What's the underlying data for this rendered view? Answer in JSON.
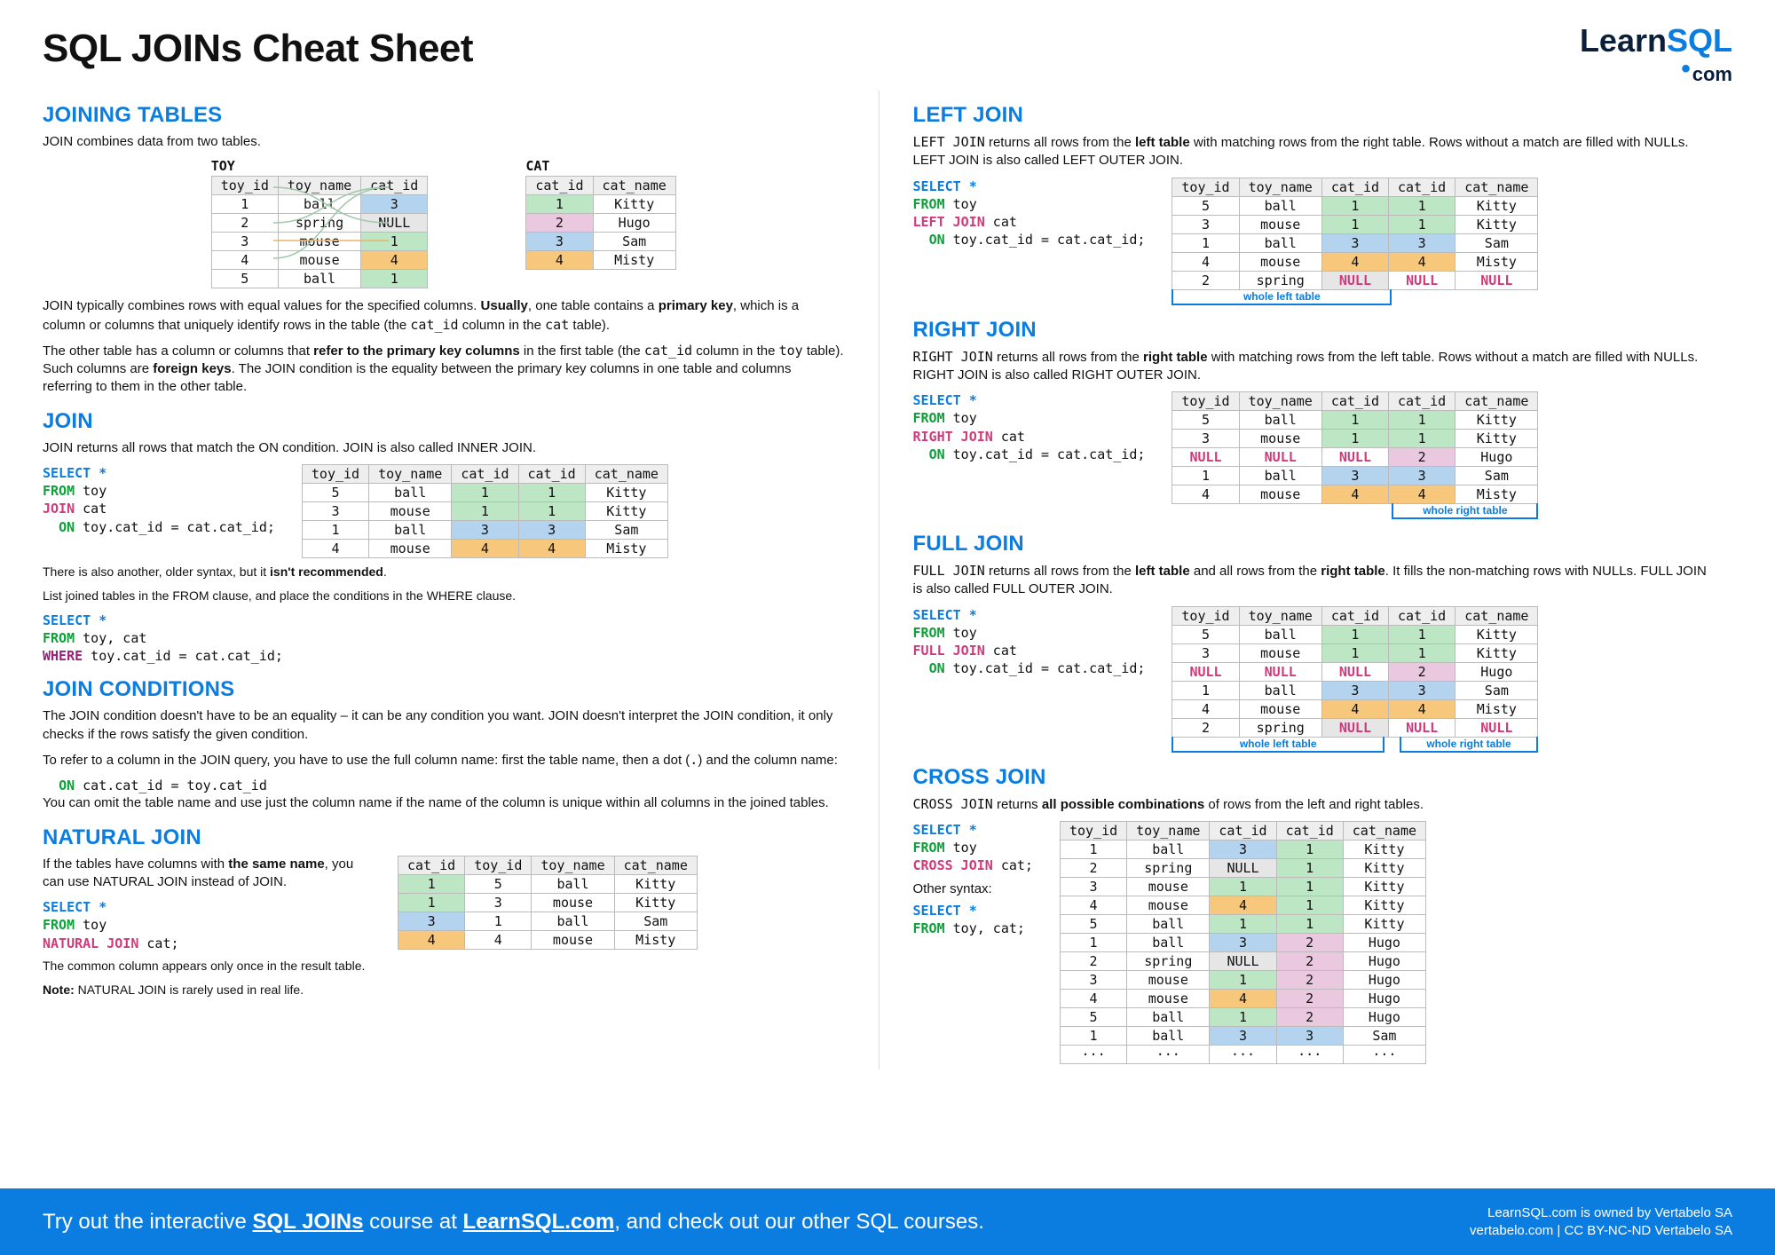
{
  "title": "SQL JOINs Cheat Sheet",
  "logo": {
    "learn": "Learn",
    "sql": "SQL",
    "com": "com"
  },
  "left": {
    "joining_tables": {
      "h": "JOINING TABLES",
      "intro": "JOIN combines data from two tables.",
      "toy_label": "TOY",
      "cat_label": "CAT",
      "toy_cols": [
        "toy_id",
        "toy_name",
        "cat_id"
      ],
      "toy_rows": [
        [
          "1",
          "ball",
          "3"
        ],
        [
          "2",
          "spring",
          "NULL"
        ],
        [
          "3",
          "mouse",
          "1"
        ],
        [
          "4",
          "mouse",
          "4"
        ],
        [
          "5",
          "ball",
          "1"
        ]
      ],
      "cat_cols": [
        "cat_id",
        "cat_name"
      ],
      "cat_rows": [
        [
          "1",
          "Kitty"
        ],
        [
          "2",
          "Hugo"
        ],
        [
          "3",
          "Sam"
        ],
        [
          "4",
          "Misty"
        ]
      ],
      "p1a": "JOIN typically combines rows with equal values for the specified columns. ",
      "p1b": "Usually",
      "p1c": ", one table contains a ",
      "p1d": "primary key",
      "p1e": ", which is a column or columns that uniquely identify rows in the table (the ",
      "p1f": "cat_id",
      "p1g": " column in the ",
      "p1h": "cat",
      "p1i": " table).",
      "p2a": "The other table has a column or columns that ",
      "p2b": "refer to the primary key columns",
      "p2c": " in the first table (the ",
      "p2d": "cat_id",
      "p2e": " column in the ",
      "p2f": "toy",
      "p2g": " table). Such columns are ",
      "p2h": "foreign keys",
      "p2i": ". The JOIN condition is the equality between the primary key columns in one table and columns referring to them in the other table."
    },
    "join": {
      "h": "JOIN",
      "intro": "JOIN returns all rows that match the ON condition. JOIN is also called INNER JOIN.",
      "sql": {
        "sel": "SELECT *",
        "from": "FROM toy",
        "join": "JOIN cat",
        "on": "  ON toy.cat_id = cat.cat_id;"
      },
      "cols": [
        "toy_id",
        "toy_name",
        "cat_id",
        "cat_id",
        "cat_name"
      ],
      "rows": [
        [
          "5",
          "ball",
          "1",
          "1",
          "Kitty"
        ],
        [
          "3",
          "mouse",
          "1",
          "1",
          "Kitty"
        ],
        [
          "1",
          "ball",
          "3",
          "3",
          "Sam"
        ],
        [
          "4",
          "mouse",
          "4",
          "4",
          "Misty"
        ]
      ],
      "note1a": "There is also another, older syntax, but it ",
      "note1b": "isn't recommended",
      "note1c": ".",
      "note2": "List joined tables in the FROM clause, and place the conditions in the WHERE clause.",
      "sql2": {
        "sel": "SELECT *",
        "from": "FROM toy, cat",
        "where": "WHERE toy.cat_id = cat.cat_id;"
      }
    },
    "join_cond": {
      "h": "JOIN CONDITIONS",
      "p1": "The JOIN condition doesn't have to be an equality – it can be any condition you want. JOIN doesn't interpret the JOIN condition, it only checks if the rows satisfy the given condition.",
      "p2a": "To refer to a column in the JOIN query, you have to use the full column name: first the table name, then a dot (",
      "p2b": ".",
      "p2c": ") and the column name:",
      "code": "  ON cat.cat_id = toy.cat_id",
      "p3": "You can omit the table name and use just the column name if the name of the column is unique within all columns in the joined tables."
    },
    "natural": {
      "h": "NATURAL JOIN",
      "p1a": "If the tables have columns with ",
      "p1b": "the same name",
      "p1c": ", you can use NATURAL JOIN instead of JOIN.",
      "sql": {
        "sel": "SELECT *",
        "from": "FROM toy",
        "join": "NATURAL JOIN cat;"
      },
      "cols": [
        "cat_id",
        "toy_id",
        "toy_name",
        "cat_name"
      ],
      "rows": [
        [
          "1",
          "5",
          "ball",
          "Kitty"
        ],
        [
          "1",
          "3",
          "mouse",
          "Kitty"
        ],
        [
          "3",
          "1",
          "ball",
          "Sam"
        ],
        [
          "4",
          "4",
          "mouse",
          "Misty"
        ]
      ],
      "p2": "The common column appears only once in the result table.",
      "p3a": "Note:",
      "p3b": " NATURAL JOIN is rarely used in real life."
    }
  },
  "right": {
    "left_join": {
      "h": "LEFT JOIN",
      "p_a": "LEFT JOIN returns all rows from the ",
      "p_b": "left table",
      "p_c": " with matching rows from the right table. Rows without a match are filled with NULLs. LEFT JOIN is also called LEFT OUTER JOIN.",
      "sql": {
        "sel": "SELECT *",
        "from": "FROM toy",
        "join": "LEFT JOIN cat",
        "on": "  ON toy.cat_id = cat.cat_id;"
      },
      "cols": [
        "toy_id",
        "toy_name",
        "cat_id",
        "cat_id",
        "cat_name"
      ],
      "rows": [
        [
          "5",
          "ball",
          "1",
          "1",
          "Kitty"
        ],
        [
          "3",
          "mouse",
          "1",
          "1",
          "Kitty"
        ],
        [
          "1",
          "ball",
          "3",
          "3",
          "Sam"
        ],
        [
          "4",
          "mouse",
          "4",
          "4",
          "Misty"
        ],
        [
          "2",
          "spring",
          "NULL",
          "NULL",
          "NULL"
        ]
      ],
      "cap": "whole left table"
    },
    "right_join": {
      "h": "RIGHT JOIN",
      "p_a": "RIGHT JOIN returns all rows from the ",
      "p_b": "right table",
      "p_c": " with matching rows from the left table. Rows without a match are filled with NULLs. RIGHT JOIN is also called RIGHT OUTER JOIN.",
      "sql": {
        "sel": "SELECT *",
        "from": "FROM toy",
        "join": "RIGHT JOIN cat",
        "on": "  ON toy.cat_id = cat.cat_id;"
      },
      "cols": [
        "toy_id",
        "toy_name",
        "cat_id",
        "cat_id",
        "cat_name"
      ],
      "rows": [
        [
          "5",
          "ball",
          "1",
          "1",
          "Kitty"
        ],
        [
          "3",
          "mouse",
          "1",
          "1",
          "Kitty"
        ],
        [
          "NULL",
          "NULL",
          "NULL",
          "2",
          "Hugo"
        ],
        [
          "1",
          "ball",
          "3",
          "3",
          "Sam"
        ],
        [
          "4",
          "mouse",
          "4",
          "4",
          "Misty"
        ]
      ],
      "cap": "whole right table"
    },
    "full_join": {
      "h": "FULL JOIN",
      "p_a": "FULL JOIN returns all rows from the ",
      "p_b": "left table",
      "p_c": " and all rows from the ",
      "p_d": "right table",
      "p_e": ". It fills the non-matching rows with NULLs. FULL JOIN is also called FULL OUTER JOIN.",
      "sql": {
        "sel": "SELECT *",
        "from": "FROM toy",
        "join": "FULL JOIN cat",
        "on": "  ON toy.cat_id = cat.cat_id;"
      },
      "cols": [
        "toy_id",
        "toy_name",
        "cat_id",
        "cat_id",
        "cat_name"
      ],
      "rows": [
        [
          "5",
          "ball",
          "1",
          "1",
          "Kitty"
        ],
        [
          "3",
          "mouse",
          "1",
          "1",
          "Kitty"
        ],
        [
          "NULL",
          "NULL",
          "NULL",
          "2",
          "Hugo"
        ],
        [
          "1",
          "ball",
          "3",
          "3",
          "Sam"
        ],
        [
          "4",
          "mouse",
          "4",
          "4",
          "Misty"
        ],
        [
          "2",
          "spring",
          "NULL",
          "NULL",
          "NULL"
        ]
      ],
      "cap_l": "whole left table",
      "cap_r": "whole right table"
    },
    "cross_join": {
      "h": "CROSS JOIN",
      "p_a": "CROSS JOIN returns ",
      "p_b": "all possible combinations",
      "p_c": " of rows from the left and right tables.",
      "sql": {
        "sel": "SELECT *",
        "from": "FROM toy",
        "join": "CROSS JOIN cat;"
      },
      "other": "Other syntax:",
      "sql2": {
        "sel": "SELECT *",
        "from": "FROM toy, cat;"
      },
      "cols": [
        "toy_id",
        "toy_name",
        "cat_id",
        "cat_id",
        "cat_name"
      ],
      "rows": [
        [
          "1",
          "ball",
          "3",
          "1",
          "Kitty"
        ],
        [
          "2",
          "spring",
          "NULL",
          "1",
          "Kitty"
        ],
        [
          "3",
          "mouse",
          "1",
          "1",
          "Kitty"
        ],
        [
          "4",
          "mouse",
          "4",
          "1",
          "Kitty"
        ],
        [
          "5",
          "ball",
          "1",
          "1",
          "Kitty"
        ],
        [
          "1",
          "ball",
          "3",
          "2",
          "Hugo"
        ],
        [
          "2",
          "spring",
          "NULL",
          "2",
          "Hugo"
        ],
        [
          "3",
          "mouse",
          "1",
          "2",
          "Hugo"
        ],
        [
          "4",
          "mouse",
          "4",
          "2",
          "Hugo"
        ],
        [
          "5",
          "ball",
          "1",
          "2",
          "Hugo"
        ],
        [
          "1",
          "ball",
          "3",
          "3",
          "Sam"
        ],
        [
          "···",
          "···",
          "···",
          "···",
          "···"
        ]
      ]
    }
  },
  "footer": {
    "l1": "Try out the interactive ",
    "l2": "SQL JOINs",
    "l3": " course at ",
    "l4": "LearnSQL.com",
    "l5": ", and check out our other SQL courses.",
    "r1": "LearnSQL.com is owned by Vertabelo SA",
    "r2": "vertabelo.com | CC BY-NC-ND Vertabelo SA"
  }
}
